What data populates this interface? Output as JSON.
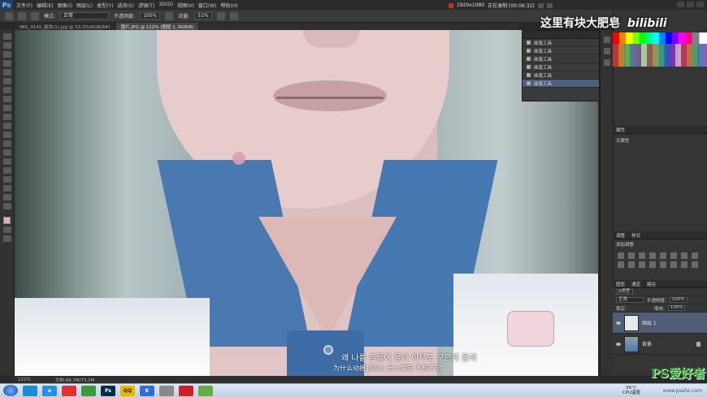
{
  "app": {
    "logo": "Ps",
    "menu": [
      "文件(F)",
      "编辑(E)",
      "图像(I)",
      "图层(L)",
      "类型(Y)",
      "选择(S)",
      "滤镜(T)",
      "3D(D)",
      "视图(V)",
      "窗口(W)",
      "帮助(H)"
    ]
  },
  "recording": {
    "resolution": "1920x1080",
    "status": "正在录制 [00:06:32]"
  },
  "options_bar": {
    "mode_label": "模式:",
    "mode_value": "正常",
    "opacity_label": "不透明度:",
    "opacity_value": "100%",
    "flow_label": "流量:",
    "flow_value": "51%"
  },
  "tabs": [
    {
      "label": "IMG_9145_副本(1).jpg @ 33.3%(RGB/8#)",
      "active": false
    },
    {
      "label": "图片.JPG @ 122% (图层 1, RGB/8)",
      "active": true
    }
  ],
  "history": {
    "items": [
      "画笔工具",
      "画笔工具",
      "画笔工具",
      "画笔工具",
      "画笔工具",
      "画笔工具"
    ],
    "selected_index": 5
  },
  "overlay": {
    "danmaku": "这里有块大肥皂",
    "brand": "bilibili",
    "subtitle_kr": "왜 나를 흔들어 몰라 아무도 모르게 몰래",
    "subtitle_cn": "为什么动摇我的心 无人察觉 不知不觉"
  },
  "properties": {
    "title": "属性",
    "content": "无属性"
  },
  "adjustments": {
    "tabs": [
      "调整",
      "样式"
    ],
    "title": "添加调整"
  },
  "layers": {
    "tabs": [
      "图层",
      "通道",
      "路径"
    ],
    "kind_label": "ρ类型",
    "blend": "正常",
    "opacity_label": "不透明度:",
    "opacity": "100%",
    "lock_label": "锁定:",
    "fill_label": "填充:",
    "fill": "100%",
    "items": [
      {
        "name": "图层 1",
        "selected": true
      },
      {
        "name": "背景",
        "selected": false
      }
    ]
  },
  "status_bar": {
    "zoom": "122%",
    "doc": "文档:68.7M/73.2M"
  },
  "taskbar": {
    "apps": [
      "e",
      "Ps",
      "QQ",
      "K"
    ],
    "tray_temp": "56°C",
    "tray_cpu": "CPU温度"
  },
  "site_watermark": {
    "name": "PS爱好者",
    "url": "www.psahz.com"
  },
  "colors": {
    "accent_selected_layer": "#515d75",
    "history_selected": "#4d5f7e",
    "record_dot": "#d62b2b"
  }
}
